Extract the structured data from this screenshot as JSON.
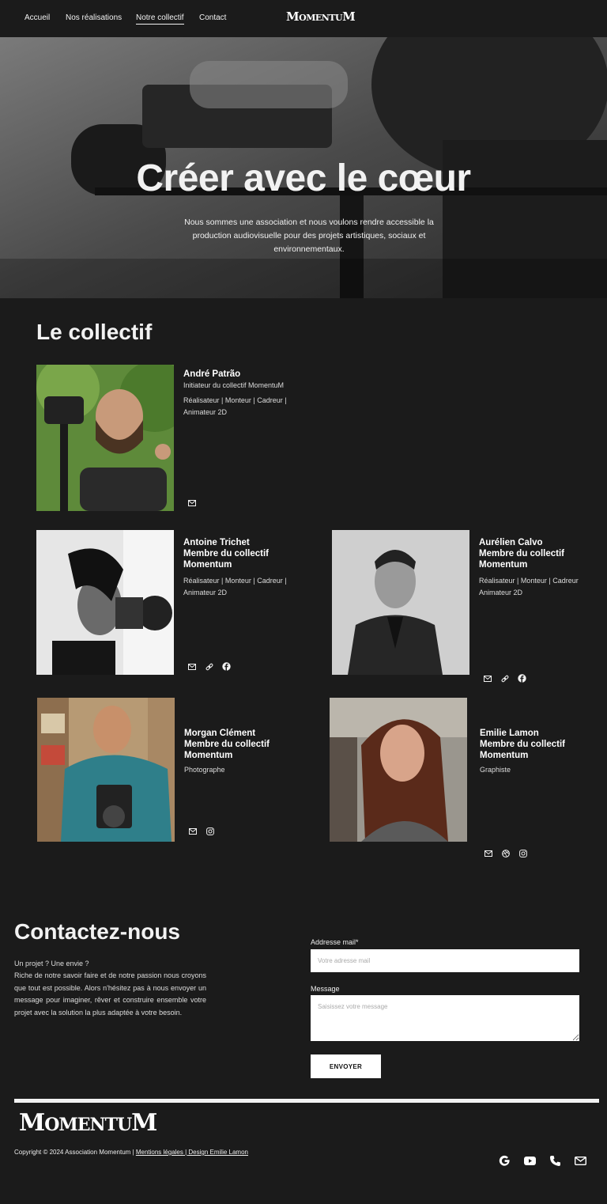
{
  "nav": {
    "items": [
      {
        "label": "Accueil"
      },
      {
        "label": "Nos réalisations"
      },
      {
        "label": "Notre collectif"
      },
      {
        "label": "Contact"
      }
    ],
    "logo": {
      "first": "M",
      "rest": "OMENTU",
      "last": "M"
    }
  },
  "hero": {
    "title": "Créer avec le cœur",
    "subtitle": "Nous sommes une association et nous voulons rendre accessible la production audiovisuelle pour des projets artistiques, sociaux et environnementaux."
  },
  "collectif": {
    "title": "Le collectif",
    "members": [
      {
        "name": "André Patrão",
        "role": "Initiateur du collectif MomentuM",
        "skills": "Réalisateur | Monteur | Cadreur | Animateur 2D",
        "icons": [
          "mail-icon"
        ]
      },
      {
        "name": "Antoine Trichet",
        "role": "Membre du collectif Momentum",
        "skills": "Réalisateur | Monteur | Cadreur | Animateur 2D",
        "icons": [
          "mail-icon",
          "link-icon",
          "facebook-icon"
        ]
      },
      {
        "name": "Aurélien Calvo",
        "role": "Membre du collectif Momentum",
        "skills": "Réalisateur | Monteur | Cadreur Animateur 2D",
        "icons": [
          "mail-icon",
          "link-icon",
          "facebook-icon"
        ]
      },
      {
        "name": "Morgan Clément",
        "role": "Membre du collectif Momentum",
        "skills": "Photographe",
        "icons": [
          "mail-icon",
          "instagram-icon"
        ]
      },
      {
        "name": "Emilie Lamon",
        "role": "Membre du collectif Momentum",
        "skills": "Graphiste",
        "icons": [
          "mail-icon",
          "dribbble-icon",
          "instagram-icon"
        ]
      }
    ]
  },
  "contact": {
    "title": "Contactez-nous",
    "lead": "Un projet ? Une envie ?",
    "text": "Riche de notre savoir faire et de notre passion nous croyons que tout est possible. Alors n'hésitez pas à nous envoyer un message pour imaginer, rêver et construire ensemble votre projet avec la solution la plus adaptée à votre besoin.",
    "email_label": "Addresse mail*",
    "email_placeholder": "Votre adresse mail",
    "message_label": "Message",
    "message_placeholder": "Saisissez votre message",
    "send_label": "ENVOYER"
  },
  "footer": {
    "logo": {
      "first": "M",
      "rest": "OMENTU",
      "last": "M"
    },
    "copyright": "Copyright © 2024 Association Momentum | ",
    "legal_link": "Mentions légales",
    "separator": " | ",
    "design_link": "Design Emilie Lamon",
    "icons": [
      "google-icon",
      "youtube-icon",
      "phone-icon",
      "mail-icon"
    ]
  },
  "colors": {
    "background": "#1b1b1b",
    "text": "#f2f2f2",
    "button": "#ffffff"
  }
}
